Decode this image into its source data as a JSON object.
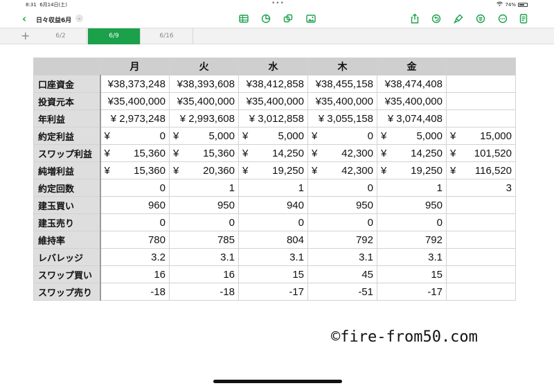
{
  "status_bar": {
    "time": "8:31",
    "date": "6月14日(土)",
    "battery": "74%",
    "battery_level": 0.74
  },
  "toolbar": {
    "back_symbol": "‹",
    "doc_title": "日々収益6月",
    "doc_chevron": "⌄",
    "icons": [
      "table-icon",
      "chart-icon",
      "shapes-icon",
      "media-icon",
      "share-icon",
      "undo-icon",
      "format-brush-icon",
      "organize-icon",
      "more-icon",
      "document-icon"
    ]
  },
  "tabs": {
    "add_symbol": "+",
    "items": [
      "6/2",
      "6/9",
      "6/16"
    ],
    "active_index": 1
  },
  "table": {
    "columns": [
      "月",
      "火",
      "水",
      "木",
      "金",
      ""
    ],
    "rows": [
      {
        "label": "口座資金",
        "cells": [
          "¥38,373,248",
          "¥38,393,608",
          "¥38,412,858",
          "¥38,455,158",
          "¥38,474,408",
          ""
        ]
      },
      {
        "label": "投資元本",
        "cells": [
          "¥35,400,000",
          "¥35,400,000",
          "¥35,400,000",
          "¥35,400,000",
          "¥35,400,000",
          ""
        ]
      },
      {
        "label": "年利益",
        "cells": [
          "¥ 2,973,248",
          "¥ 2,993,608",
          "¥ 3,012,858",
          "¥ 3,055,158",
          "¥ 3,074,408",
          ""
        ]
      },
      {
        "label": "約定利益",
        "currency": true,
        "cells": [
          "0",
          "5,000",
          "5,000",
          "0",
          "5,000",
          "15,000"
        ]
      },
      {
        "label": "スワップ利益",
        "currency": true,
        "cells": [
          "15,360",
          "15,360",
          "14,250",
          "42,300",
          "14,250",
          "101,520"
        ]
      },
      {
        "label": "純増利益",
        "currency": true,
        "cells": [
          "15,360",
          "20,360",
          "19,250",
          "42,300",
          "19,250",
          "116,520"
        ]
      },
      {
        "label": "約定回数",
        "cells": [
          "0",
          "1",
          "1",
          "0",
          "1",
          "3"
        ]
      },
      {
        "label": "建玉買い",
        "cells": [
          "960",
          "950",
          "940",
          "950",
          "950",
          ""
        ]
      },
      {
        "label": "建玉売り",
        "cells": [
          "0",
          "0",
          "0",
          "0",
          "0",
          ""
        ]
      },
      {
        "label": "維持率",
        "cells": [
          "780",
          "785",
          "804",
          "792",
          "792",
          ""
        ]
      },
      {
        "label": "レバレッジ",
        "cells": [
          "3.2",
          "3.1",
          "3.1",
          "3.1",
          "3.1",
          ""
        ]
      },
      {
        "label": "スワップ買い",
        "cells": [
          "16",
          "16",
          "15",
          "45",
          "15",
          ""
        ]
      },
      {
        "label": "スワップ売り",
        "cells": [
          "-18",
          "-18",
          "-17",
          "-51",
          "-17",
          ""
        ]
      }
    ],
    "currency_symbol": "¥"
  },
  "watermark": "©fire-from50.com",
  "colors": {
    "accent": "#1aa14a",
    "header_bg": "#cfcfcf"
  }
}
